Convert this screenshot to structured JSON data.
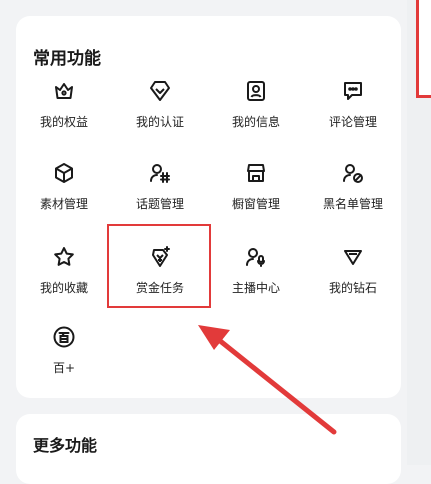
{
  "common": {
    "title": "常用功能",
    "items": [
      {
        "label": "我的权益",
        "icon": "crown-icon"
      },
      {
        "label": "我的认证",
        "icon": "verify-shield-icon"
      },
      {
        "label": "我的信息",
        "icon": "profile-card-icon"
      },
      {
        "label": "评论管理",
        "icon": "comment-icon"
      },
      {
        "label": "素材管理",
        "icon": "cube-icon"
      },
      {
        "label": "话题管理",
        "icon": "topic-hash-icon"
      },
      {
        "label": "橱窗管理",
        "icon": "storefront-icon"
      },
      {
        "label": "黑名单管理",
        "icon": "blocked-user-icon"
      },
      {
        "label": "我的收藏",
        "icon": "star-icon"
      },
      {
        "label": "赏金任务",
        "icon": "bounty-diamond-icon"
      },
      {
        "label": "主播中心",
        "icon": "streamer-mic-icon"
      },
      {
        "label": "我的钻石",
        "icon": "diamond-icon"
      },
      {
        "label": "百+",
        "icon": "bai-plus-icon"
      }
    ]
  },
  "more": {
    "title": "更多功能"
  },
  "annotation_color": "#e23a3a"
}
